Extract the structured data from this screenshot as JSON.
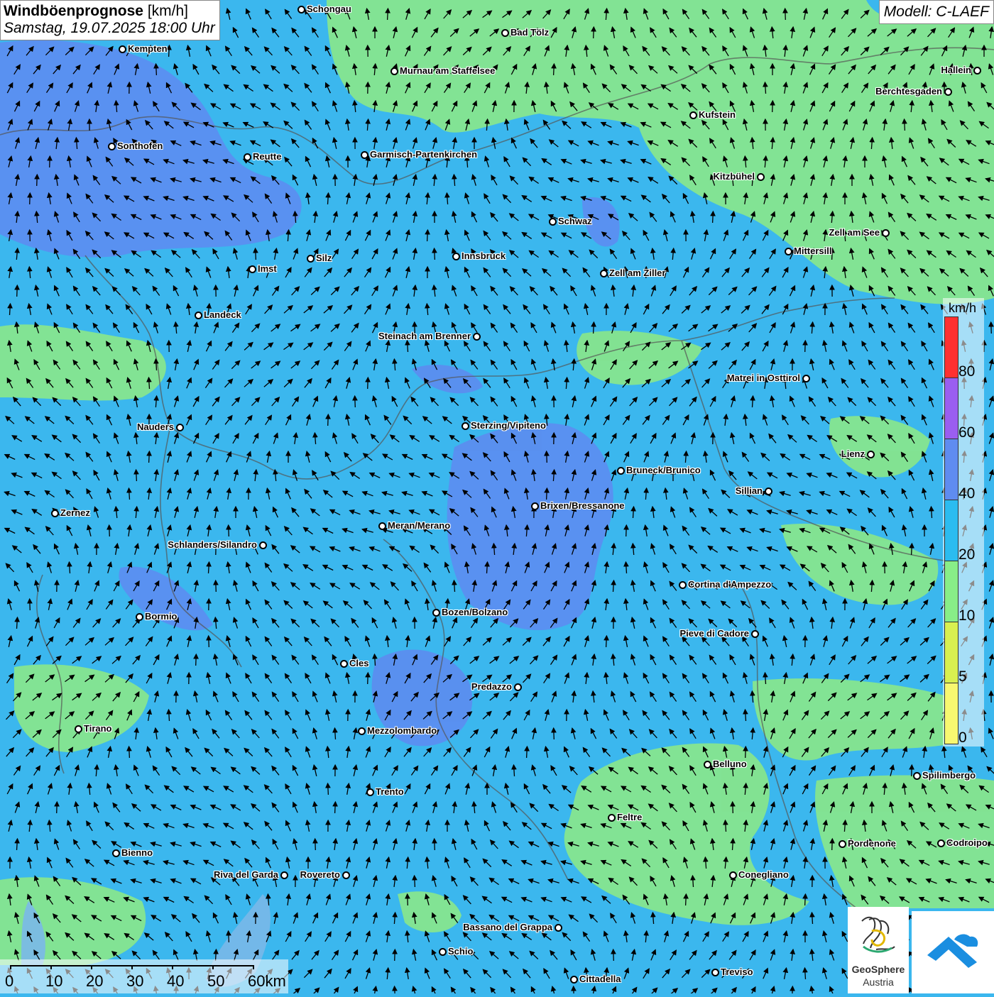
{
  "header": {
    "title_bold": "Windböenprognose",
    "title_unit": "[km/h]",
    "datetime": "Samstag, 19.07.2025 18:00 Uhr",
    "model": "Modell: C-LAEF"
  },
  "legend": {
    "unit": "km/h",
    "labels": [
      "80",
      "60",
      "40",
      "20",
      "10",
      "5",
      "0"
    ],
    "colors": [
      "#ff3030",
      "#9a5ef0",
      "#5f8cf0",
      "#2bbcf0",
      "#88ee88",
      "#d8f050",
      "#f8f870"
    ]
  },
  "scale_bar": {
    "labels": [
      "0",
      "10",
      "20",
      "30",
      "40",
      "50",
      "60km"
    ]
  },
  "logos": {
    "geosphere_name": "GeoSphere",
    "geosphere_sub": "Austria"
  },
  "cities": [
    {
      "name": "Schongau",
      "side": "right"
    },
    {
      "name": "Bad Tölz",
      "side": "right"
    },
    {
      "name": "Kempten",
      "side": "right"
    },
    {
      "name": "Murnau am Staffelsee",
      "side": "right"
    },
    {
      "name": "Hallein",
      "side": "left"
    },
    {
      "name": "Berchtesgaden",
      "side": "left"
    },
    {
      "name": "Kufstein",
      "side": "right"
    },
    {
      "name": "Sonthofen",
      "side": "right"
    },
    {
      "name": "Reutte",
      "side": "right"
    },
    {
      "name": "Garmisch-Partenkirchen",
      "side": "right"
    },
    {
      "name": "Kitzbühel",
      "side": "left"
    },
    {
      "name": "Schwaz",
      "side": "right"
    },
    {
      "name": "Zell am See",
      "side": "left"
    },
    {
      "name": "Mittersill",
      "side": "right"
    },
    {
      "name": "Innsbruck",
      "side": "right"
    },
    {
      "name": "Silz",
      "side": "right"
    },
    {
      "name": "Imst",
      "side": "right"
    },
    {
      "name": "Zell am Ziller",
      "side": "right"
    },
    {
      "name": "Landeck",
      "side": "right"
    },
    {
      "name": "Steinach am Brenner",
      "side": "left"
    },
    {
      "name": "Matrei in Osttirol",
      "side": "left"
    },
    {
      "name": "Nauders",
      "side": "left"
    },
    {
      "name": "Sterzing/Vipiteno",
      "side": "right"
    },
    {
      "name": "Lienz",
      "side": "left"
    },
    {
      "name": "Bruneck/Brunico",
      "side": "right"
    },
    {
      "name": "Sillian",
      "side": "left"
    },
    {
      "name": "Zernez",
      "side": "right"
    },
    {
      "name": "Brixen/Bressanone",
      "side": "right"
    },
    {
      "name": "Meran/Merano",
      "side": "right"
    },
    {
      "name": "Schlanders/Silandro",
      "side": "left"
    },
    {
      "name": "Cortina d'Ampezzo",
      "side": "right"
    },
    {
      "name": "Bozen/Bolzano",
      "side": "right"
    },
    {
      "name": "Bormio",
      "side": "right"
    },
    {
      "name": "Pieve di Cadore",
      "side": "left"
    },
    {
      "name": "Cles",
      "side": "right"
    },
    {
      "name": "Predazzo",
      "side": "left"
    },
    {
      "name": "Tirano",
      "side": "right"
    },
    {
      "name": "Mezzolombardo",
      "side": "right"
    },
    {
      "name": "Belluno",
      "side": "right"
    },
    {
      "name": "Spilimbergo",
      "side": "right"
    },
    {
      "name": "Trento",
      "side": "right"
    },
    {
      "name": "Feltre",
      "side": "right"
    },
    {
      "name": "Pordenone",
      "side": "right"
    },
    {
      "name": "Codroipo",
      "side": "right"
    },
    {
      "name": "Bienno",
      "side": "right"
    },
    {
      "name": "Riva del Garda",
      "side": "left"
    },
    {
      "name": "Rovereto",
      "side": "left"
    },
    {
      "name": "Conegliano",
      "side": "right"
    },
    {
      "name": "Bassano del Grappa",
      "side": "left"
    },
    {
      "name": "Schio",
      "side": "right"
    },
    {
      "name": "Treviso",
      "side": "right"
    },
    {
      "name": "Cittadella",
      "side": "right"
    }
  ]
}
